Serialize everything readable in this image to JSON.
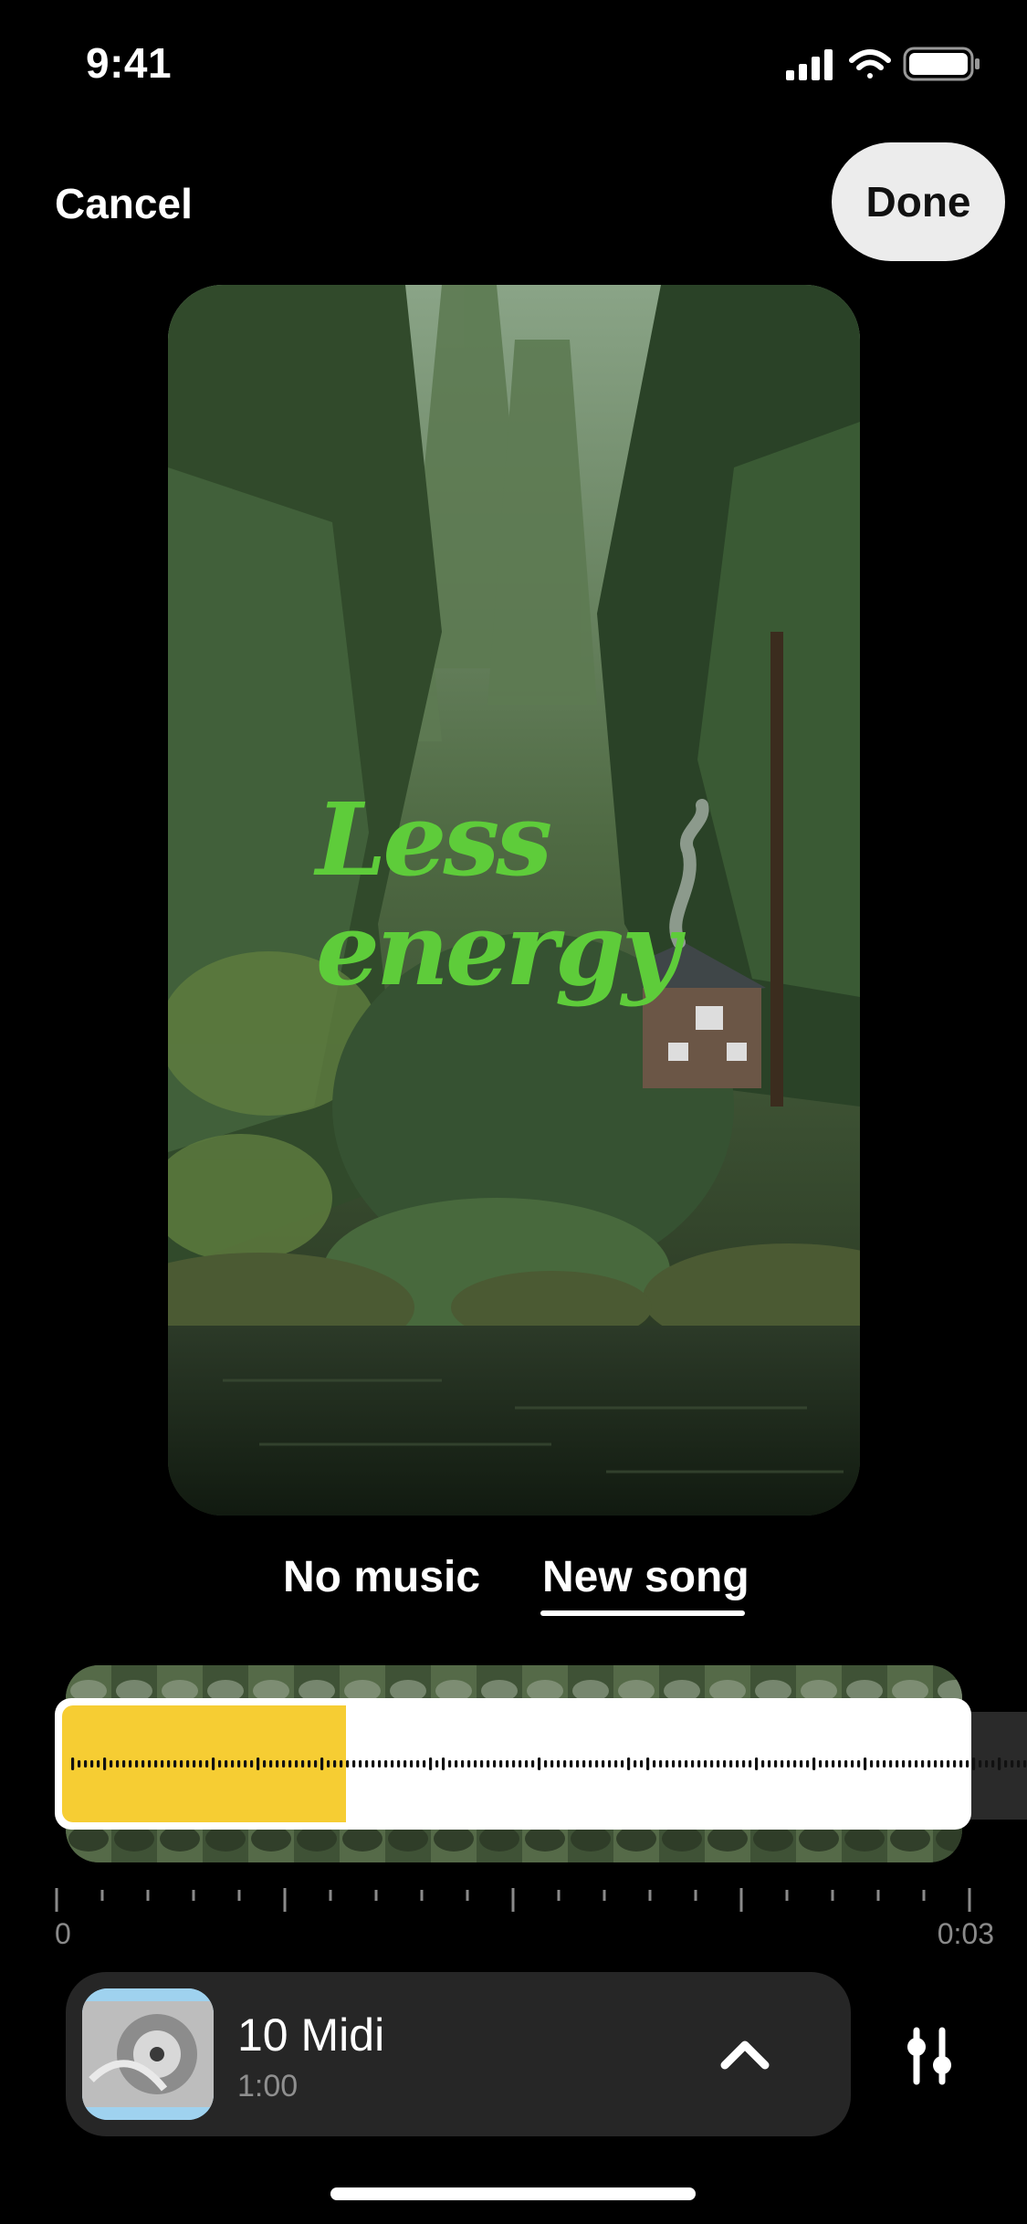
{
  "status_bar": {
    "time": "9:41",
    "icons": [
      "signal-icon",
      "wifi-icon",
      "battery-icon"
    ]
  },
  "top_bar": {
    "cancel_label": "Cancel",
    "done_label": "Done"
  },
  "preview": {
    "overlay_text_line1": "Less",
    "overlay_text_line2": "energy",
    "overlay_color": "#5ecc3a"
  },
  "tabs": [
    {
      "label": "No music",
      "selected": false
    },
    {
      "label": "New song",
      "selected": true
    }
  ],
  "timeline": {
    "selection_fraction": 0.31,
    "start_label": "0",
    "end_label": "0:03",
    "selection_color": "#f6cd33"
  },
  "song": {
    "title": "10 Midi",
    "duration": "1:00",
    "expand_icon": "chevron-up-icon",
    "adjust_icon": "sliders-icon"
  }
}
